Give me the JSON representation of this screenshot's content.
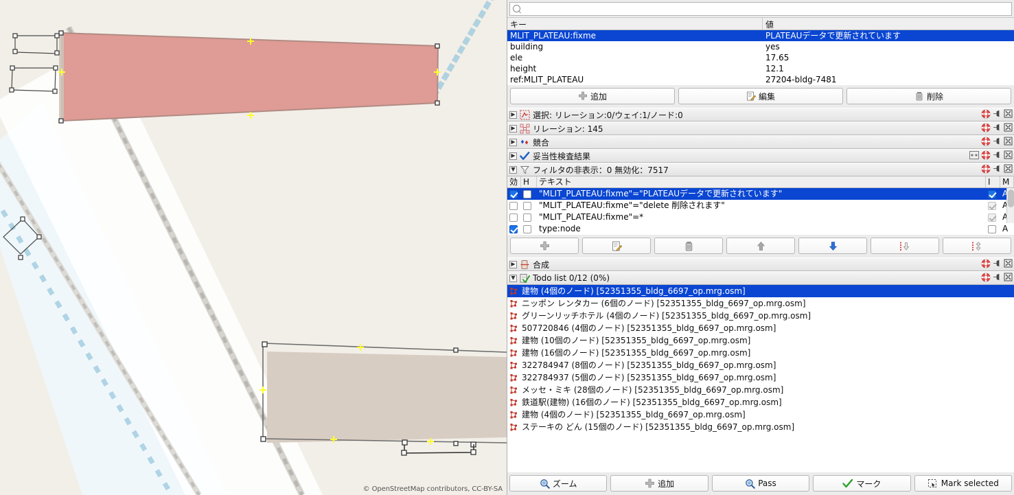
{
  "map": {
    "attribution": "© OpenStreetMap contributors, CC-BY-SA",
    "background_color": "#f2efe8",
    "selected_building_fill": "#df9b95",
    "selected_building_stroke": "#b08b84",
    "building_fill": "#d8cdc3",
    "water_color": "#cfe8f3",
    "railway_color": "#9ac9de",
    "node_color": "#3a3a3a",
    "midpoint_color": "#ffff2e"
  },
  "search": {
    "value": "",
    "placeholder": "",
    "icon": "search-icon"
  },
  "tags": {
    "columns": [
      "キー",
      "値"
    ],
    "rows": [
      {
        "key": "MLIT_PLATEAU:fixme",
        "value": "PLATEAUデータで更新されています",
        "selected": true
      },
      {
        "key": "building",
        "value": "yes",
        "selected": false
      },
      {
        "key": "ele",
        "value": "17.65",
        "selected": false
      },
      {
        "key": "height",
        "value": "12.1",
        "selected": false
      },
      {
        "key": "ref:MLIT_PLATEAU",
        "value": "27204-bldg-7481",
        "selected": false
      }
    ]
  },
  "tag_buttons": [
    {
      "label": "追加",
      "icon": "plus-icon"
    },
    {
      "label": "編集",
      "icon": "edit-icon"
    },
    {
      "label": "削除",
      "icon": "trash-icon"
    }
  ],
  "sections": [
    {
      "name": "selection",
      "title": "選択: リレーション:0/ウェイ:1/ノード:0",
      "icon": "selection-icon",
      "expanded": false
    },
    {
      "name": "relations",
      "title": "リレーション: 145",
      "icon": "relation-icon",
      "expanded": false
    },
    {
      "name": "conflicts",
      "title": "競合",
      "icon": "conflict-icon",
      "expanded": false
    },
    {
      "name": "validation",
      "title": "妥当性検査結果",
      "icon": "check-icon",
      "expanded": false
    },
    {
      "name": "filters",
      "title": "フィルタの非表示：0 無効化：7517",
      "icon": "funnel-icon",
      "expanded": true
    }
  ],
  "filters": {
    "columns": [
      "効",
      "H",
      "テキスト",
      "I",
      "M"
    ],
    "rows": [
      {
        "enabled": true,
        "hidden": false,
        "text": "\"MLIT_PLATEAU:fixme\"=\"PLATEAUデータで更新されています\"",
        "inverted": true,
        "mode": "A",
        "selected": true
      },
      {
        "enabled": false,
        "hidden": false,
        "text": "\"MLIT_PLATEAU:fixme\"=\"delete 削除されます\"",
        "inverted": false,
        "mode": "A",
        "selected": false
      },
      {
        "enabled": false,
        "hidden": false,
        "text": "\"MLIT_PLATEAU:fixme\"=*",
        "inverted": false,
        "mode": "A",
        "selected": false
      },
      {
        "enabled": true,
        "hidden": false,
        "text": "type:node",
        "inverted": false,
        "mode": "A",
        "selected": false
      }
    ]
  },
  "filter_buttons": [
    {
      "name": "add-filter",
      "icon": "plus-icon"
    },
    {
      "name": "edit-filter",
      "icon": "edit-icon"
    },
    {
      "name": "delete-filter",
      "icon": "trash-icon"
    },
    {
      "name": "move-up-filter",
      "icon": "arrow-up-icon"
    },
    {
      "name": "move-down-filter",
      "icon": "arrow-down-icon"
    },
    {
      "name": "sort-down-filter",
      "icon": "sort-down-icon"
    },
    {
      "name": "sort-updown-filter",
      "icon": "sort-updown-icon"
    }
  ],
  "merge_section": {
    "title": "合成",
    "icon": "merge-icon",
    "expanded": false
  },
  "todo_section": {
    "title": "Todo list 0/12 (0%)",
    "icon": "todo-icon",
    "expanded": true
  },
  "todo_items": [
    {
      "text": "建物 (4個のノード) [52351355_bldg_6697_op.mrg.osm]",
      "selected": true
    },
    {
      "text": "ニッポン レンタカー (6個のノード) [52351355_bldg_6697_op.mrg.osm]",
      "selected": false
    },
    {
      "text": "グリーンリッチホテル (4個のノード) [52351355_bldg_6697_op.mrg.osm]",
      "selected": false
    },
    {
      "text": "507720846 (4個のノード) [52351355_bldg_6697_op.mrg.osm]",
      "selected": false
    },
    {
      "text": "建物 (10個のノード) [52351355_bldg_6697_op.mrg.osm]",
      "selected": false
    },
    {
      "text": "建物 (16個のノード) [52351355_bldg_6697_op.mrg.osm]",
      "selected": false
    },
    {
      "text": "322784947 (8個のノード) [52351355_bldg_6697_op.mrg.osm]",
      "selected": false
    },
    {
      "text": "322784937 (5個のノード) [52351355_bldg_6697_op.mrg.osm]",
      "selected": false
    },
    {
      "text": "メッセ・ミキ (28個のノード) [52351355_bldg_6697_op.mrg.osm]",
      "selected": false
    },
    {
      "text": "鉄道駅(建物) (16個のノード) [52351355_bldg_6697_op.mrg.osm]",
      "selected": false
    },
    {
      "text": "建物 (4個のノード) [52351355_bldg_6697_op.mrg.osm]",
      "selected": false
    },
    {
      "text": "ステーキの どん (15個のノード) [52351355_bldg_6697_op.mrg.osm]",
      "selected": false
    }
  ],
  "todo_buttons": [
    {
      "label": "ズーム",
      "icon": "zoom-icon"
    },
    {
      "label": "追加",
      "icon": "plus-icon"
    },
    {
      "label": "Pass",
      "icon": "zoom-icon"
    },
    {
      "label": "マーク",
      "icon": "check-icon"
    },
    {
      "label": "Mark selected",
      "icon": "marquee-icon"
    }
  ],
  "colors": {
    "selection_blue": "#0a46d2",
    "panel_bg": "#ececec",
    "list_bg": "#ffffff",
    "header_gradient_top": "#f4f4f4",
    "header_gradient_bottom": "#e4e4e4"
  }
}
